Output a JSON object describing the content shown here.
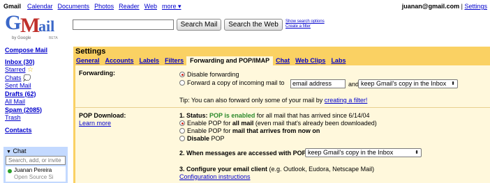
{
  "topbar": {
    "brand": "Gmail",
    "nav": [
      "Calendar",
      "Documents",
      "Photos",
      "Reader",
      "Web",
      "more ▾"
    ],
    "email": "juanan@gmail.com",
    "separator": "|",
    "settings": "Settings"
  },
  "logo": {
    "text": "Gmail",
    "by": "by Google",
    "beta": "BETA"
  },
  "search": {
    "value": "",
    "search_mail": "Search Mail",
    "search_web": "Search the Web",
    "show_options": "Show search options",
    "create_filter": "Create a filter"
  },
  "sidebar": {
    "compose": "Compose Mail",
    "inbox": "Inbox (30)",
    "starred": "Starred",
    "chats": "Chats",
    "sent": "Sent Mail",
    "drafts": "Drafts (62)",
    "all": "All Mail",
    "spam": "Spam (2085)",
    "trash": "Trash",
    "contacts": "Contacts"
  },
  "chat": {
    "header": "Chat",
    "search_placeholder": "Search, add, or invite",
    "contact_name": "Juanan Pereira",
    "contact_status": "Open Source Si"
  },
  "settings": {
    "title": "Settings",
    "tabs": [
      "General",
      "Accounts",
      "Labels",
      "Filters",
      "Forwarding and POP/IMAP",
      "Chat",
      "Web Clips",
      "Labs"
    ],
    "forwarding": {
      "label": "Forwarding:",
      "disable": "Disable forwarding",
      "forward_copy": "Forward a copy of incoming mail to",
      "email_placeholder": "email address",
      "and": "and",
      "keep_select": "keep Gmail's copy in the Inbox",
      "tip": "Tip: You can also forward only some of your mail by",
      "tip_link": "creating a filter!"
    },
    "pop": {
      "label": "POP Download:",
      "learn_more": "Learn more",
      "status_prefix": "1. Status:",
      "status_enabled": "POP is enabled",
      "status_suffix": "for all mail that has arrived since 6/14/04",
      "opt1_a": "Enable POP for",
      "opt1_b": "all mail",
      "opt1_c": "(even mail that's already been downloaded)",
      "opt2_a": "Enable POP for",
      "opt2_b": "mail that arrives from now on",
      "opt3_a": "Disable",
      "opt3_b": "POP",
      "when_label": "2. When messages are accessed with POP",
      "when_select": "keep Gmail's copy in the Inbox",
      "configure_a": "3. Configure your email client",
      "configure_b": "(e.g. Outlook, Eudora, Netscape Mail)",
      "config_link": "Configuration instructions"
    }
  }
}
